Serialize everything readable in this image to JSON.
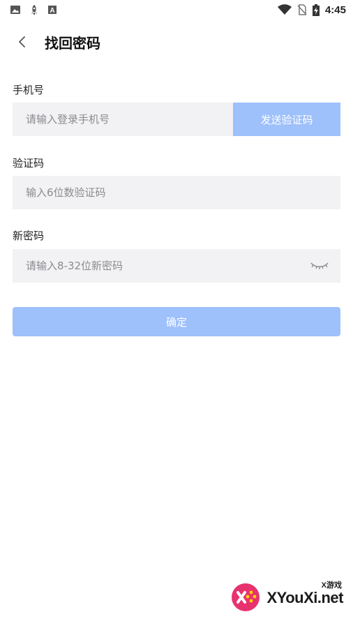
{
  "status_bar": {
    "time": "4:45",
    "left_icons": [
      "image-icon",
      "rocket-icon",
      "font-app-icon"
    ],
    "right_icons": [
      "wifi-icon",
      "no-sim-icon",
      "battery-charging-icon"
    ]
  },
  "header": {
    "title": "找回密码"
  },
  "form": {
    "phone": {
      "label": "手机号",
      "placeholder": "请输入登录手机号",
      "value": "",
      "send_code_label": "发送验证码"
    },
    "code": {
      "label": "验证码",
      "placeholder": "输入6位数验证码",
      "value": ""
    },
    "password": {
      "label": "新密码",
      "placeholder": "请输入8-32位新密码",
      "value": ""
    },
    "confirm_label": "确定"
  },
  "watermark": {
    "small": "X游戏",
    "main": "XYouXi.net"
  },
  "colors": {
    "accent_disabled": "#9ec0fb",
    "field_bg": "#f2f2f4",
    "placeholder": "#8b8b90"
  }
}
